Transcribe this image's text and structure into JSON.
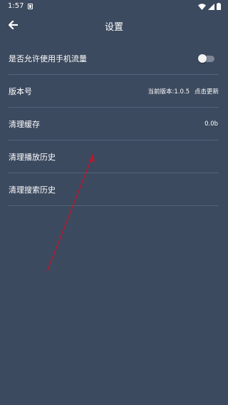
{
  "status_bar": {
    "time": "1:57",
    "icons": [
      "notification-icon",
      "wifi-icon",
      "signal-icon",
      "battery-icon"
    ]
  },
  "header": {
    "title": "设置",
    "back_icon": "arrow-left-icon"
  },
  "settings": {
    "mobile_data": {
      "label": "是否允许使用手机流量",
      "enabled": false
    },
    "version": {
      "label": "版本号",
      "current": "当前版本:1.0.5",
      "update": "点击更新"
    },
    "clear_cache": {
      "label": "清理缓存",
      "value": "0.0b"
    },
    "clear_play_history": {
      "label": "清理播放历史"
    },
    "clear_search_history": {
      "label": "清理搜索历史"
    }
  },
  "colors": {
    "background": "#3c4a5f",
    "divider": "#55627a",
    "annotation_arrow": "#c0152a"
  }
}
